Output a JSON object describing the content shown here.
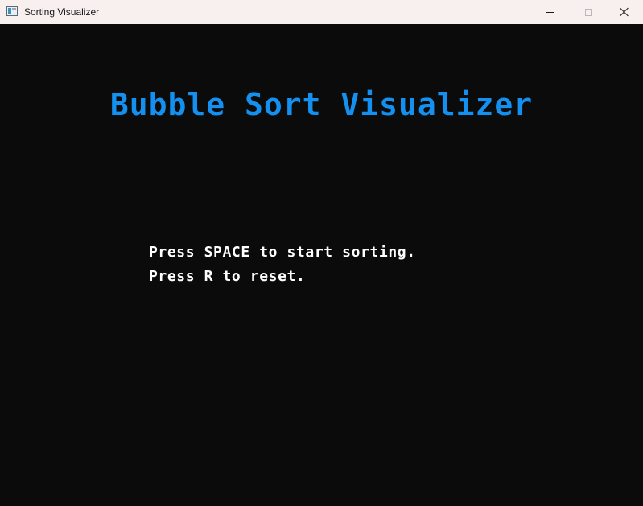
{
  "window": {
    "title": "Sorting Visualizer",
    "icons": {
      "app": "app-window-icon",
      "minimize": "minimize-icon",
      "maximize": "maximize-icon",
      "close": "close-icon"
    }
  },
  "game": {
    "title": "Bubble Sort Visualizer",
    "instructions": [
      "Press SPACE to start sorting.",
      "Press R to reset."
    ]
  },
  "colors": {
    "background": "#0b0b0b",
    "title_text": "#1390f0",
    "instruction_text": "#ffffff",
    "titlebar": "#f7f0ee"
  }
}
